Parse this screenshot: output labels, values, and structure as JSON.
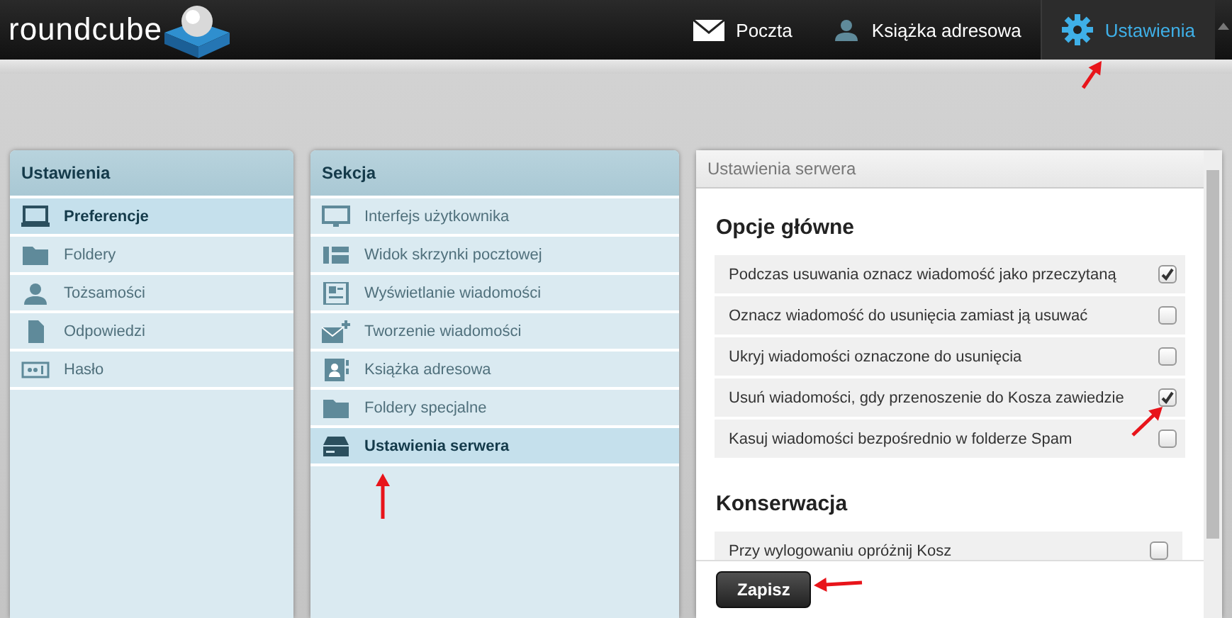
{
  "logo": {
    "text": "roundcube"
  },
  "nav": [
    {
      "label": "Poczta",
      "kind": "mail",
      "selected": false
    },
    {
      "label": "Książka adresowa",
      "kind": "person",
      "selected": false
    },
    {
      "label": "Ustawienia",
      "kind": "gear",
      "selected": true
    }
  ],
  "settings_panel": {
    "title": "Ustawienia",
    "items": [
      {
        "label": "Preferencje",
        "kind": "laptop",
        "selected": true
      },
      {
        "label": "Foldery",
        "kind": "folder",
        "selected": false
      },
      {
        "label": "Tożsamości",
        "kind": "person",
        "selected": false
      },
      {
        "label": "Odpowiedzi",
        "kind": "doc",
        "selected": false
      },
      {
        "label": "Hasło",
        "kind": "password",
        "selected": false
      }
    ]
  },
  "section_panel": {
    "title": "Sekcja",
    "items": [
      {
        "label": "Interfejs użytkownika",
        "kind": "monitor",
        "selected": false
      },
      {
        "label": "Widok skrzynki pocztowej",
        "kind": "layout",
        "selected": false
      },
      {
        "label": "Wyświetlanie wiadomości",
        "kind": "article",
        "selected": false
      },
      {
        "label": "Tworzenie wiadomości",
        "kind": "compose",
        "selected": false
      },
      {
        "label": "Książka adresowa",
        "kind": "addressbook",
        "selected": false
      },
      {
        "label": "Foldery specjalne",
        "kind": "folder",
        "selected": false
      },
      {
        "label": "Ustawienia serwera",
        "kind": "server",
        "selected": true
      }
    ]
  },
  "content": {
    "title": "Ustawienia serwera",
    "groups": [
      {
        "heading": "Opcje główne",
        "options": [
          {
            "label": "Podczas usuwania oznacz wiadomość jako przeczytaną",
            "checked": true
          },
          {
            "label": "Oznacz wiadomość do usunięcia zamiast ją usuwać",
            "checked": false
          },
          {
            "label": "Ukryj wiadomości oznaczone do usunięcia",
            "checked": false
          },
          {
            "label": "Usuń wiadomości, gdy przenoszenie do Kosza zawiedzie",
            "checked": true
          },
          {
            "label": "Kasuj wiadomości bezpośrednio w folderze Spam",
            "checked": false
          }
        ]
      },
      {
        "heading": "Konserwacja",
        "options": [
          {
            "label": "Przy wylogowaniu opróżnij Kosz",
            "checked": false
          }
        ]
      }
    ],
    "save_button": "Zapisz"
  }
}
